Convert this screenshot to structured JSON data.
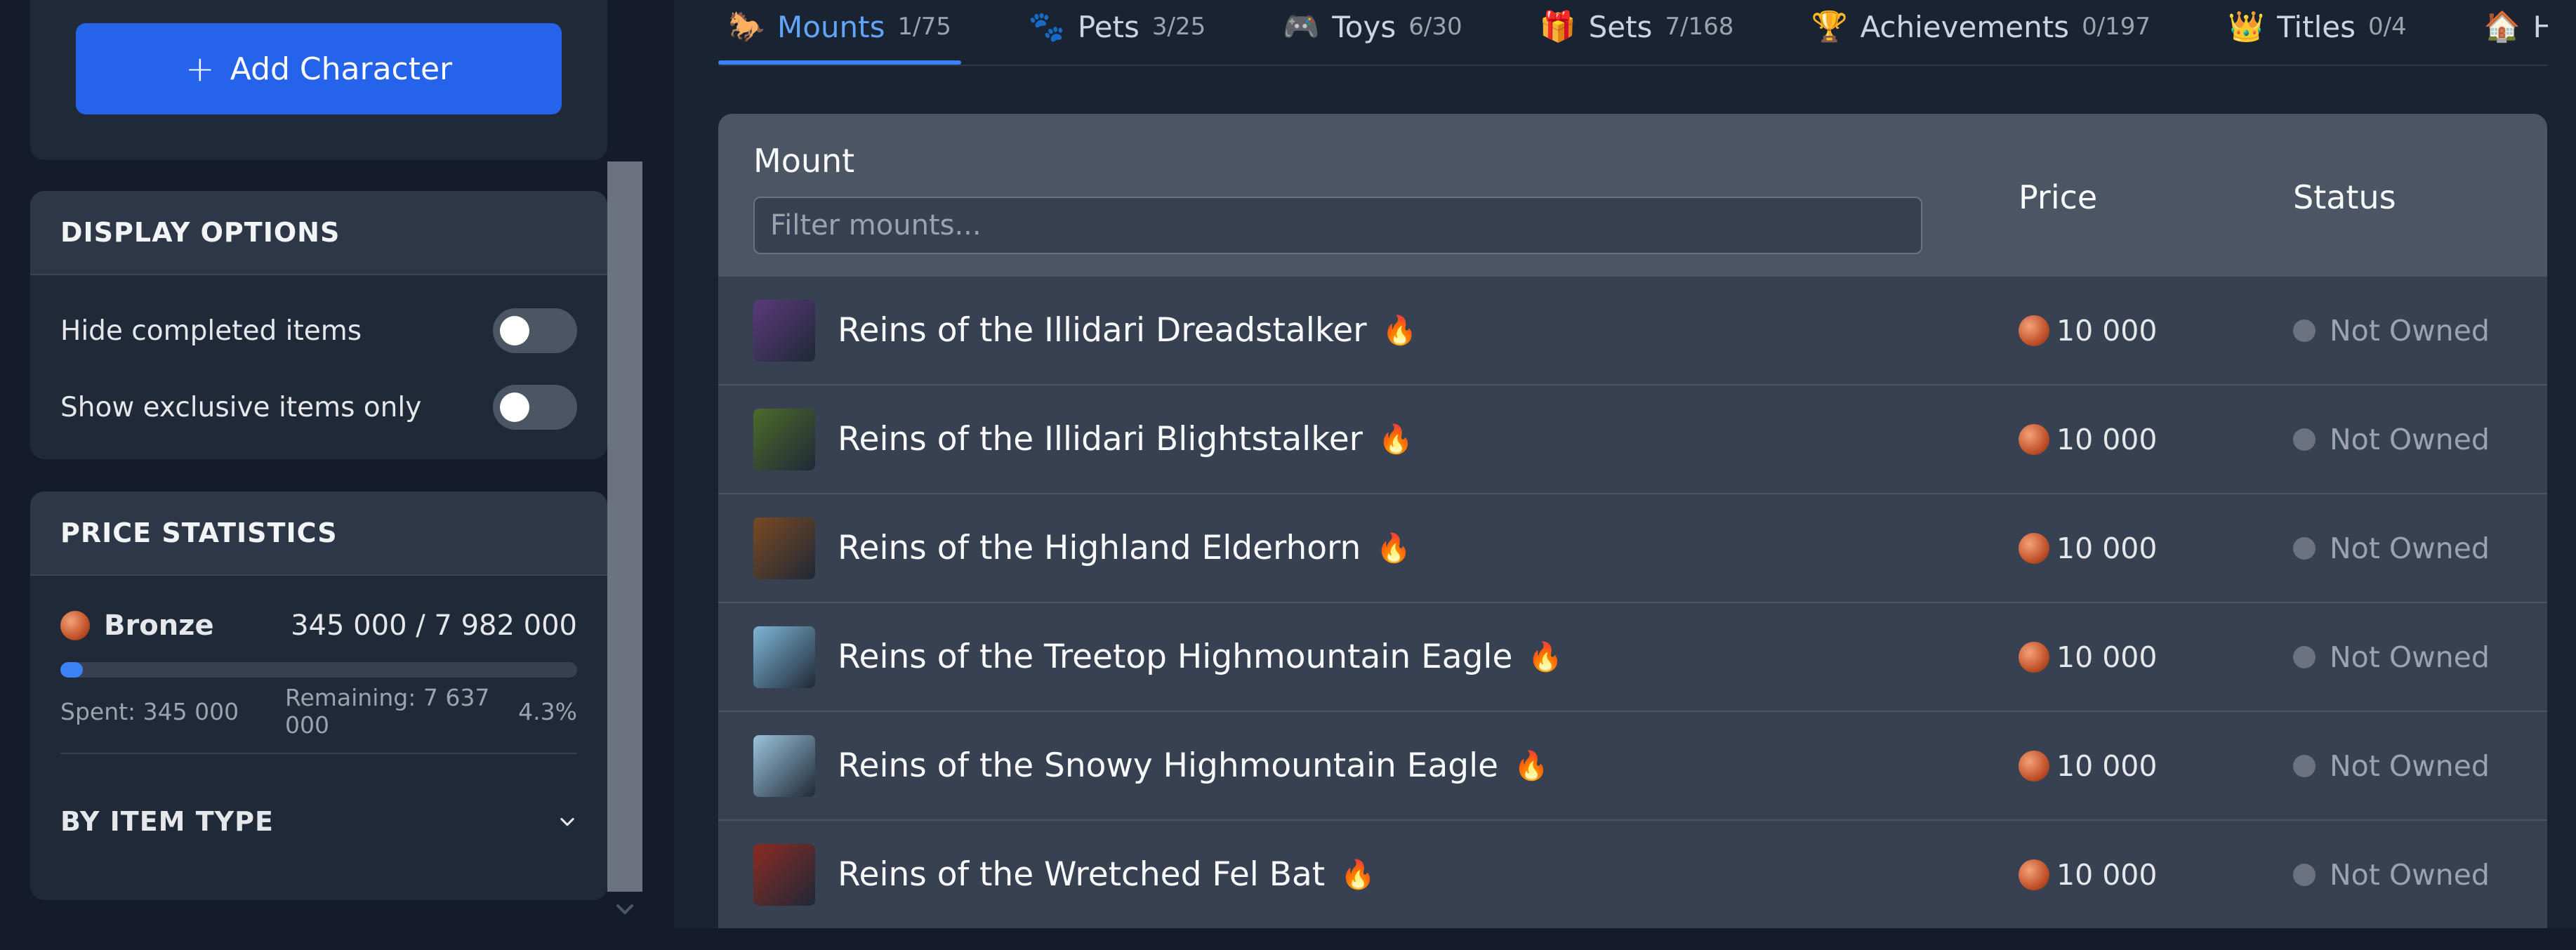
{
  "sidebar": {
    "add_character_label": "Add Character",
    "display_options": {
      "title": "DISPLAY OPTIONS",
      "options": [
        {
          "label": "Hide completed items",
          "enabled": false
        },
        {
          "label": "Show exclusive items only",
          "enabled": false
        }
      ]
    },
    "price_statistics": {
      "title": "PRICE STATISTICS",
      "currency": "Bronze",
      "total": "345 000 / 7 982 000",
      "progress_fraction": 0.043,
      "spent": "Spent: 345 000",
      "remaining": "Remaining: 7 637 000",
      "percent": "4.3%",
      "by_item_type": "BY ITEM TYPE"
    }
  },
  "tabs": [
    {
      "icon": "🐎",
      "label": "Mounts",
      "count": "1/75",
      "active": true
    },
    {
      "icon": "🐾",
      "label": "Pets",
      "count": "3/25"
    },
    {
      "icon": "🎮",
      "label": "Toys",
      "count": "6/30"
    },
    {
      "icon": "🎁",
      "label": "Sets",
      "count": "7/168"
    },
    {
      "icon": "🏆",
      "label": "Achievements",
      "count": "0/197"
    },
    {
      "icon": "👑",
      "label": "Titles",
      "count": "0/4"
    },
    {
      "icon": "🏠",
      "label": "Hou",
      "count": ""
    }
  ],
  "table": {
    "columns": {
      "mount": "Mount",
      "price": "Price",
      "status": "Status"
    },
    "filter_placeholder": "Filter mounts...",
    "rows": [
      {
        "name": "Reins of the Illidari Dreadstalker",
        "price": "10 000",
        "status": "Not Owned",
        "thumb_color": "#5b3a7a"
      },
      {
        "name": "Reins of the Illidari Blightstalker",
        "price": "10 000",
        "status": "Not Owned",
        "thumb_color": "#4d6b2a"
      },
      {
        "name": "Reins of the Highland Elderhorn",
        "price": "10 000",
        "status": "Not Owned",
        "thumb_color": "#7a4a22"
      },
      {
        "name": "Reins of the Treetop Highmountain Eagle",
        "price": "10 000",
        "status": "Not Owned",
        "thumb_color": "#7fb6d6"
      },
      {
        "name": "Reins of the Snowy Highmountain Eagle",
        "price": "10 000",
        "status": "Not Owned",
        "thumb_color": "#9cc4dc"
      },
      {
        "name": "Reins of the Wretched Fel Bat",
        "price": "10 000",
        "status": "Not Owned",
        "thumb_color": "#8a2a22"
      }
    ]
  },
  "colors": {
    "accent": "#2563eb",
    "active_tab": "#60a5fa",
    "fire": "#f97316"
  }
}
